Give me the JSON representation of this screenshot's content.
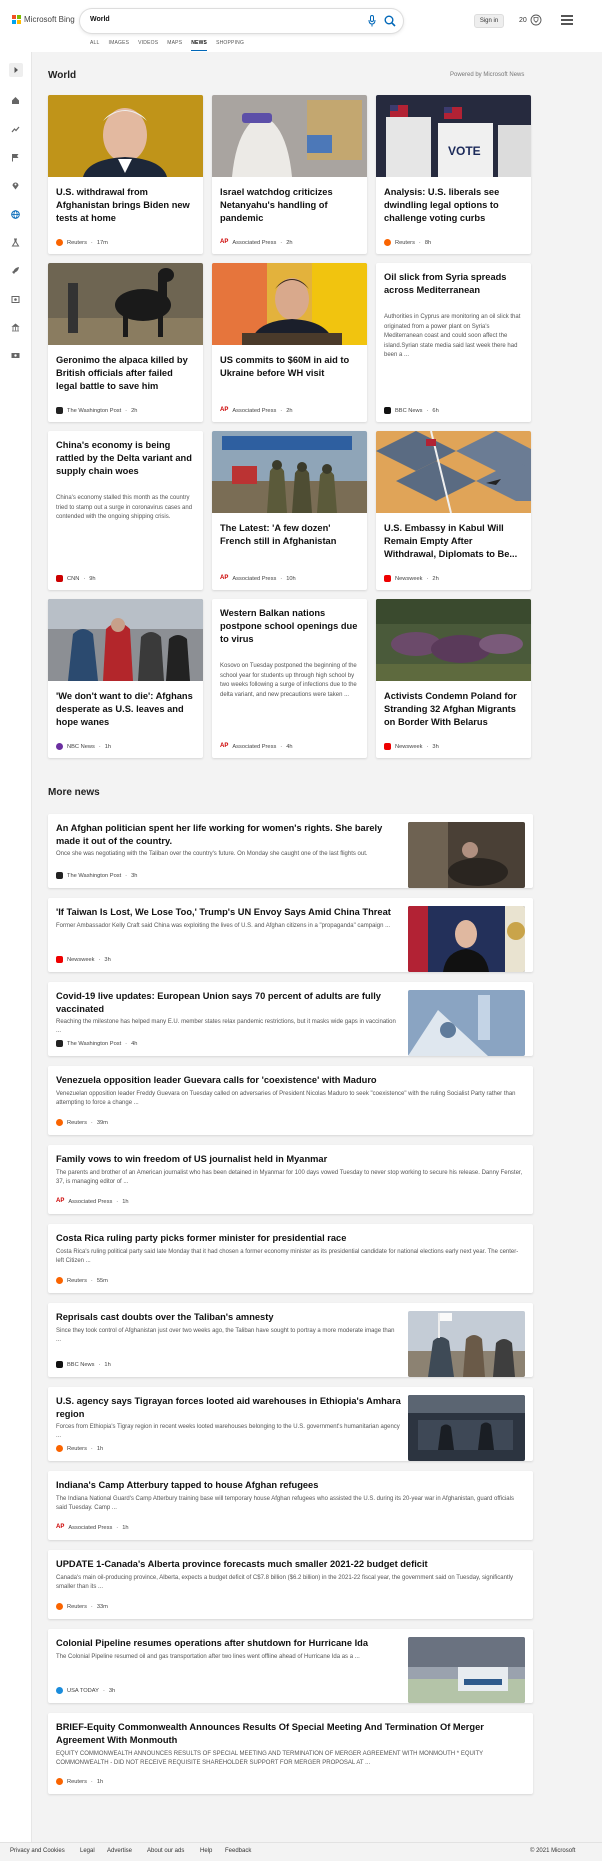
{
  "header": {
    "brand": "Microsoft Bing",
    "search_value": "World",
    "sign_in": "Sign in",
    "rewards_points": "20",
    "tabs": [
      "ALL",
      "IMAGES",
      "VIDEOS",
      "MAPS",
      "NEWS",
      "SHOPPING"
    ],
    "active_tab": "NEWS",
    "colors": {
      "accent": "#0067b8",
      "logo_red": "#f25022",
      "logo_green": "#7fba00",
      "logo_blue": "#00a4ef",
      "logo_yellow": "#ffb900"
    }
  },
  "rail": {
    "icons": [
      "expand-icon",
      "home-icon",
      "trending-icon",
      "flag-icon",
      "location-icon",
      "globe-icon",
      "science-icon",
      "rocket-icon",
      "entertainment-icon",
      "business-icon",
      "money-icon"
    ]
  },
  "world": {
    "title": "World",
    "powered_by": "Powered by Microsoft News",
    "cards": [
      {
        "title": "U.S. withdrawal from Afghanistan brings Biden new tests at home",
        "snippet": "",
        "source": "Reuters",
        "time": "17m",
        "source_icon": "reuters-logo",
        "image": true
      },
      {
        "title": "Israel watchdog criticizes Netanyahu's handling of pandemic",
        "snippet": "",
        "source": "Associated Press",
        "time": "2h",
        "source_icon": "ap-logo",
        "image": true
      },
      {
        "title": "Analysis: U.S. liberals see dwindling legal options to challenge voting curbs",
        "snippet": "",
        "source": "Reuters",
        "time": "8h",
        "source_icon": "reuters-logo",
        "image": true
      },
      {
        "title": "Geronimo the alpaca killed by British officials after failed legal battle to save him",
        "snippet": "",
        "source": "The Washington Post",
        "time": "2h",
        "source_icon": "wapo-logo",
        "image": true
      },
      {
        "title": "US commits to $60M in aid to Ukraine before WH visit",
        "snippet": "",
        "source": "Associated Press",
        "time": "2h",
        "source_icon": "ap-logo",
        "image": true
      },
      {
        "title": "Oil slick from Syria spreads across Mediterranean",
        "snippet": "Authorities in Cyprus are monitoring an oil slick that originated from a power plant on Syria's Mediterranean coast and could soon affect the island.Syrian state media said last week there had been a ...",
        "source": "BBC News",
        "time": "6h",
        "source_icon": "bbc-logo",
        "image": false
      },
      {
        "title": "China's economy is being rattled by the Delta variant and supply chain woes",
        "snippet": "China's economy stalled this month as the country tried to stamp out a surge in coronavirus cases and contended with the ongoing shipping crisis.",
        "source": "CNN",
        "time": "9h",
        "source_icon": "cnn-logo",
        "image": false
      },
      {
        "title": "The Latest: 'A few dozen' French still in Afghanistan",
        "snippet": "",
        "source": "Associated Press",
        "time": "10h",
        "source_icon": "ap-logo",
        "image": true
      },
      {
        "title": "U.S. Embassy in Kabul Will Remain Empty After Withdrawal, Diplomats to Be...",
        "snippet": "",
        "source": "Newsweek",
        "time": "2h",
        "source_icon": "newsweek-logo",
        "image": true
      },
      {
        "title": "'We don't want to die': Afghans desperate as U.S. leaves and hope wanes",
        "snippet": "",
        "source": "NBC News",
        "time": "1h",
        "source_icon": "nbc-logo",
        "image": true
      },
      {
        "title": "Western Balkan nations postpone school openings due to virus",
        "snippet": "Kosovo on Tuesday postponed the beginning of the school year for students up through high school by two weeks following a surge of infections due to the delta variant, and new precautions were taken ...",
        "source": "Associated Press",
        "time": "4h",
        "source_icon": "ap-logo",
        "image": false
      },
      {
        "title": "Activists Condemn Poland for Stranding 32 Afghan Migrants on Border With Belarus",
        "snippet": "",
        "source": "Newsweek",
        "time": "3h",
        "source_icon": "newsweek-logo",
        "image": true
      }
    ]
  },
  "more_news": {
    "title": "More news",
    "items": [
      {
        "title": "An Afghan politician spent her life working for women's rights. She barely made it out of the country.",
        "snippet": "Once she was negotiating with the Taliban over the country's future. On Monday she caught one of the last flights out.",
        "source": "The Washington Post",
        "time": "3h",
        "source_icon": "wapo-logo",
        "thumb": true
      },
      {
        "title": "'If Taiwan Is Lost, We Lose Too,' Trump's UN Envoy Says Amid China Threat",
        "snippet": "Former Ambassador Kelly Craft said China was exploiting the lives of U.S. and Afghan citizens in a \"propaganda\" campaign ...",
        "source": "Newsweek",
        "time": "3h",
        "source_icon": "newsweek-logo",
        "thumb": true
      },
      {
        "title": "Covid-19 live updates: European Union says 70 percent of adults are fully vaccinated",
        "snippet": "Reaching the milestone has helped many E.U. member states relax pandemic restrictions, but it masks wide gaps in vaccination ...",
        "source": "The Washington Post",
        "time": "4h",
        "source_icon": "wapo-logo",
        "thumb": true
      },
      {
        "title": "Venezuela opposition leader Guevara calls for 'coexistence' with Maduro",
        "snippet": "Venezuelan opposition leader Freddy Guevara on Tuesday called on adversaries of President Nicolas Maduro to seek \"coexistence\" with the ruling Socialist Party rather than attempting to force a change ...",
        "source": "Reuters",
        "time": "39m",
        "source_icon": "reuters-logo",
        "thumb": false
      },
      {
        "title": "Family vows to win freedom of US journalist held in Myanmar",
        "snippet": "The parents and brother of an American journalist who has been detained in Myanmar for 100 days vowed Tuesday to never stop working to secure his release. Danny Fenster, 37, is managing editor of ...",
        "source": "Associated Press",
        "time": "1h",
        "source_icon": "ap-logo",
        "thumb": false
      },
      {
        "title": "Costa Rica ruling party picks former minister for presidential race",
        "snippet": "Costa Rica's ruling political party said late Monday that it had chosen a former economy minister as its presidential candidate for national elections early next year. The center-left Citizen ...",
        "source": "Reuters",
        "time": "55m",
        "source_icon": "reuters-logo",
        "thumb": false
      },
      {
        "title": "Reprisals cast doubts over the Taliban's amnesty",
        "snippet": "Since they took control of Afghanistan just over two weeks ago, the Taliban have sought to portray a more moderate image than ...",
        "source": "BBC News",
        "time": "1h",
        "source_icon": "bbc-logo",
        "thumb": true
      },
      {
        "title": "U.S. agency says Tigrayan forces looted aid warehouses in Ethiopia's Amhara region",
        "snippet": "Forces from Ethiopia's Tigray region in recent weeks looted warehouses belonging to the U.S. government's humanitarian agency ...",
        "source": "Reuters",
        "time": "1h",
        "source_icon": "reuters-logo",
        "thumb": true
      },
      {
        "title": "Indiana's Camp Atterbury tapped to house Afghan refugees",
        "snippet": "The Indiana National Guard's Camp Atterbury training base will temporary house Afghan refugees who assisted the U.S. during its 20-year war in Afghanistan, guard officials said Tuesday. Camp ...",
        "source": "Associated Press",
        "time": "1h",
        "source_icon": "ap-logo",
        "thumb": false
      },
      {
        "title": "UPDATE 1-Canada's Alberta province forecasts much smaller 2021-22 budget deficit",
        "snippet": "Canada's main oil-producing province, Alberta, expects a budget deficit of C$7.8 billion ($6.2 billion) in the 2021-22 fiscal year, the government said on Tuesday, significantly smaller than its ...",
        "source": "Reuters",
        "time": "33m",
        "source_icon": "reuters-logo",
        "thumb": false
      },
      {
        "title": "Colonial Pipeline resumes operations after shutdown for Hurricane Ida",
        "snippet": "The Colonial Pipeline resumed oil and gas transportation after two lines went offline ahead of Hurricane Ida as a ...",
        "source": "USA TODAY",
        "time": "3h",
        "source_icon": "usatoday-logo",
        "thumb": true
      },
      {
        "title": "BRIEF-Equity Commonwealth Announces Results Of Special Meeting And Termination Of Merger Agreement With Monmouth",
        "snippet": "EQUITY COMMONWEALTH ANNOUNCES RESULTS OF SPECIAL MEETING AND TERMINATION OF MERGER AGREEMENT WITH MONMOUTH * EQUITY COMMONWEALTH - DID NOT RECEIVE REQUISITE SHAREHOLDER SUPPORT FOR MERGER PROPOSAL AT ...",
        "source": "Reuters",
        "time": "1h",
        "source_icon": "reuters-logo",
        "thumb": false
      }
    ]
  },
  "footer": {
    "links": [
      "Privacy and Cookies",
      "Legal",
      "Advertise",
      "About our ads",
      "Help",
      "Feedback"
    ],
    "copyright": "© 2021 Microsoft"
  }
}
